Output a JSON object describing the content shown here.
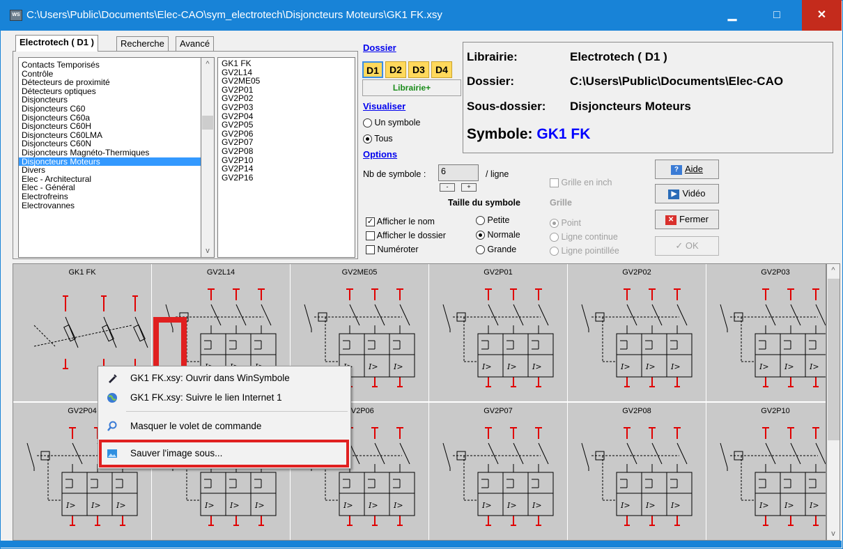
{
  "window": {
    "title": "C:\\Users\\Public\\Documents\\Elec-CAO\\sym_electrotech\\Disjoncteurs Moteurs\\GK1 FK.xsy",
    "app_icon_text": "WS",
    "minimize": "▁",
    "maximize": "□",
    "close": "✕"
  },
  "tabs": [
    "Electrotech ( D1 )",
    "Recherche",
    "Avancé"
  ],
  "categories": [
    "Contacts Temporisés",
    "Contrôle",
    "Détecteurs de proximité",
    "Détecteurs optiques",
    "Disjoncteurs",
    "Disjoncteurs C60",
    "Disjoncteurs C60a",
    "Disjoncteurs C60H",
    "Disjoncteurs C60LMA",
    "Disjoncteurs C60N",
    "Disjoncteurs Magnéto-Thermiques",
    "Disjoncteurs Moteurs",
    "Divers",
    "Elec - Architectural",
    "Elec - Général",
    "Electrofreins",
    "Electrovannes"
  ],
  "selected_category": "Disjoncteurs Moteurs",
  "symbols": [
    "GK1 FK",
    "GV2L14",
    "GV2ME05",
    "GV2P01",
    "GV2P02",
    "GV2P03",
    "GV2P04",
    "GV2P05",
    "GV2P06",
    "GV2P07",
    "GV2P08",
    "GV2P10",
    "GV2P14",
    "GV2P16"
  ],
  "dossier": {
    "heading": "Dossier",
    "folders": [
      "D1",
      "D2",
      "D3",
      "D4"
    ],
    "librairie_button": "Librairie+"
  },
  "visualiser": {
    "heading": "Visualiser",
    "un_symbole": "Un symbole",
    "tous": "Tous",
    "selected": "Tous"
  },
  "options": {
    "heading": "Options",
    "nb_label": "Nb de symbole :",
    "nb_value": "6",
    "per_line": "/ ligne",
    "minus": "-",
    "plus": "+",
    "grille_inch": "Grille en inch",
    "taille_heading": "Taille du symbole",
    "grille_heading": "Grille",
    "afficher_nom": "Afficher le nom",
    "afficher_dossier": "Afficher le dossier",
    "numeroter": "Numéroter",
    "taille": [
      "Petite",
      "Normale",
      "Grande"
    ],
    "taille_selected": "Normale",
    "grille": [
      "Point",
      "Ligne continue",
      "Ligne pointillée"
    ],
    "grille_selected": "Point"
  },
  "info": {
    "librairie_label": "Librairie:",
    "librairie_value": "Electrotech ( D1 )",
    "dossier_label": "Dossier:",
    "dossier_value": "C:\\Users\\Public\\Documents\\Elec-CAO",
    "sousdossier_label": "Sous-dossier:",
    "sousdossier_value": "Disjoncteurs Moteurs",
    "symbole_label": "Symbole:",
    "symbole_value": "GK1 FK",
    "symbole_color": "#0000ff"
  },
  "buttons": {
    "aide": "Aide",
    "video": "Vidéo",
    "fermer": "Fermer",
    "ok": "OK"
  },
  "grid_cells": [
    "GK1 FK",
    "GV2L14",
    "GV2ME05",
    "GV2P01",
    "GV2P02",
    "GV2P03",
    "GV2P04",
    "",
    "GV2P06",
    "GV2P07",
    "GV2P08",
    "GV2P10"
  ],
  "context_menu": {
    "item1": "GK1 FK.xsy: Ouvrir dans WinSymbole",
    "item2": "GK1 FK.xsy: Suivre le lien Internet 1",
    "item3": "Masquer le volet de commande",
    "item4": "Sauver l'image sous..."
  },
  "colors": {
    "titlebar": "#1883d7",
    "selection": "#3399ff",
    "highlight_red": "#e02020",
    "schematic_red": "#e00000"
  }
}
